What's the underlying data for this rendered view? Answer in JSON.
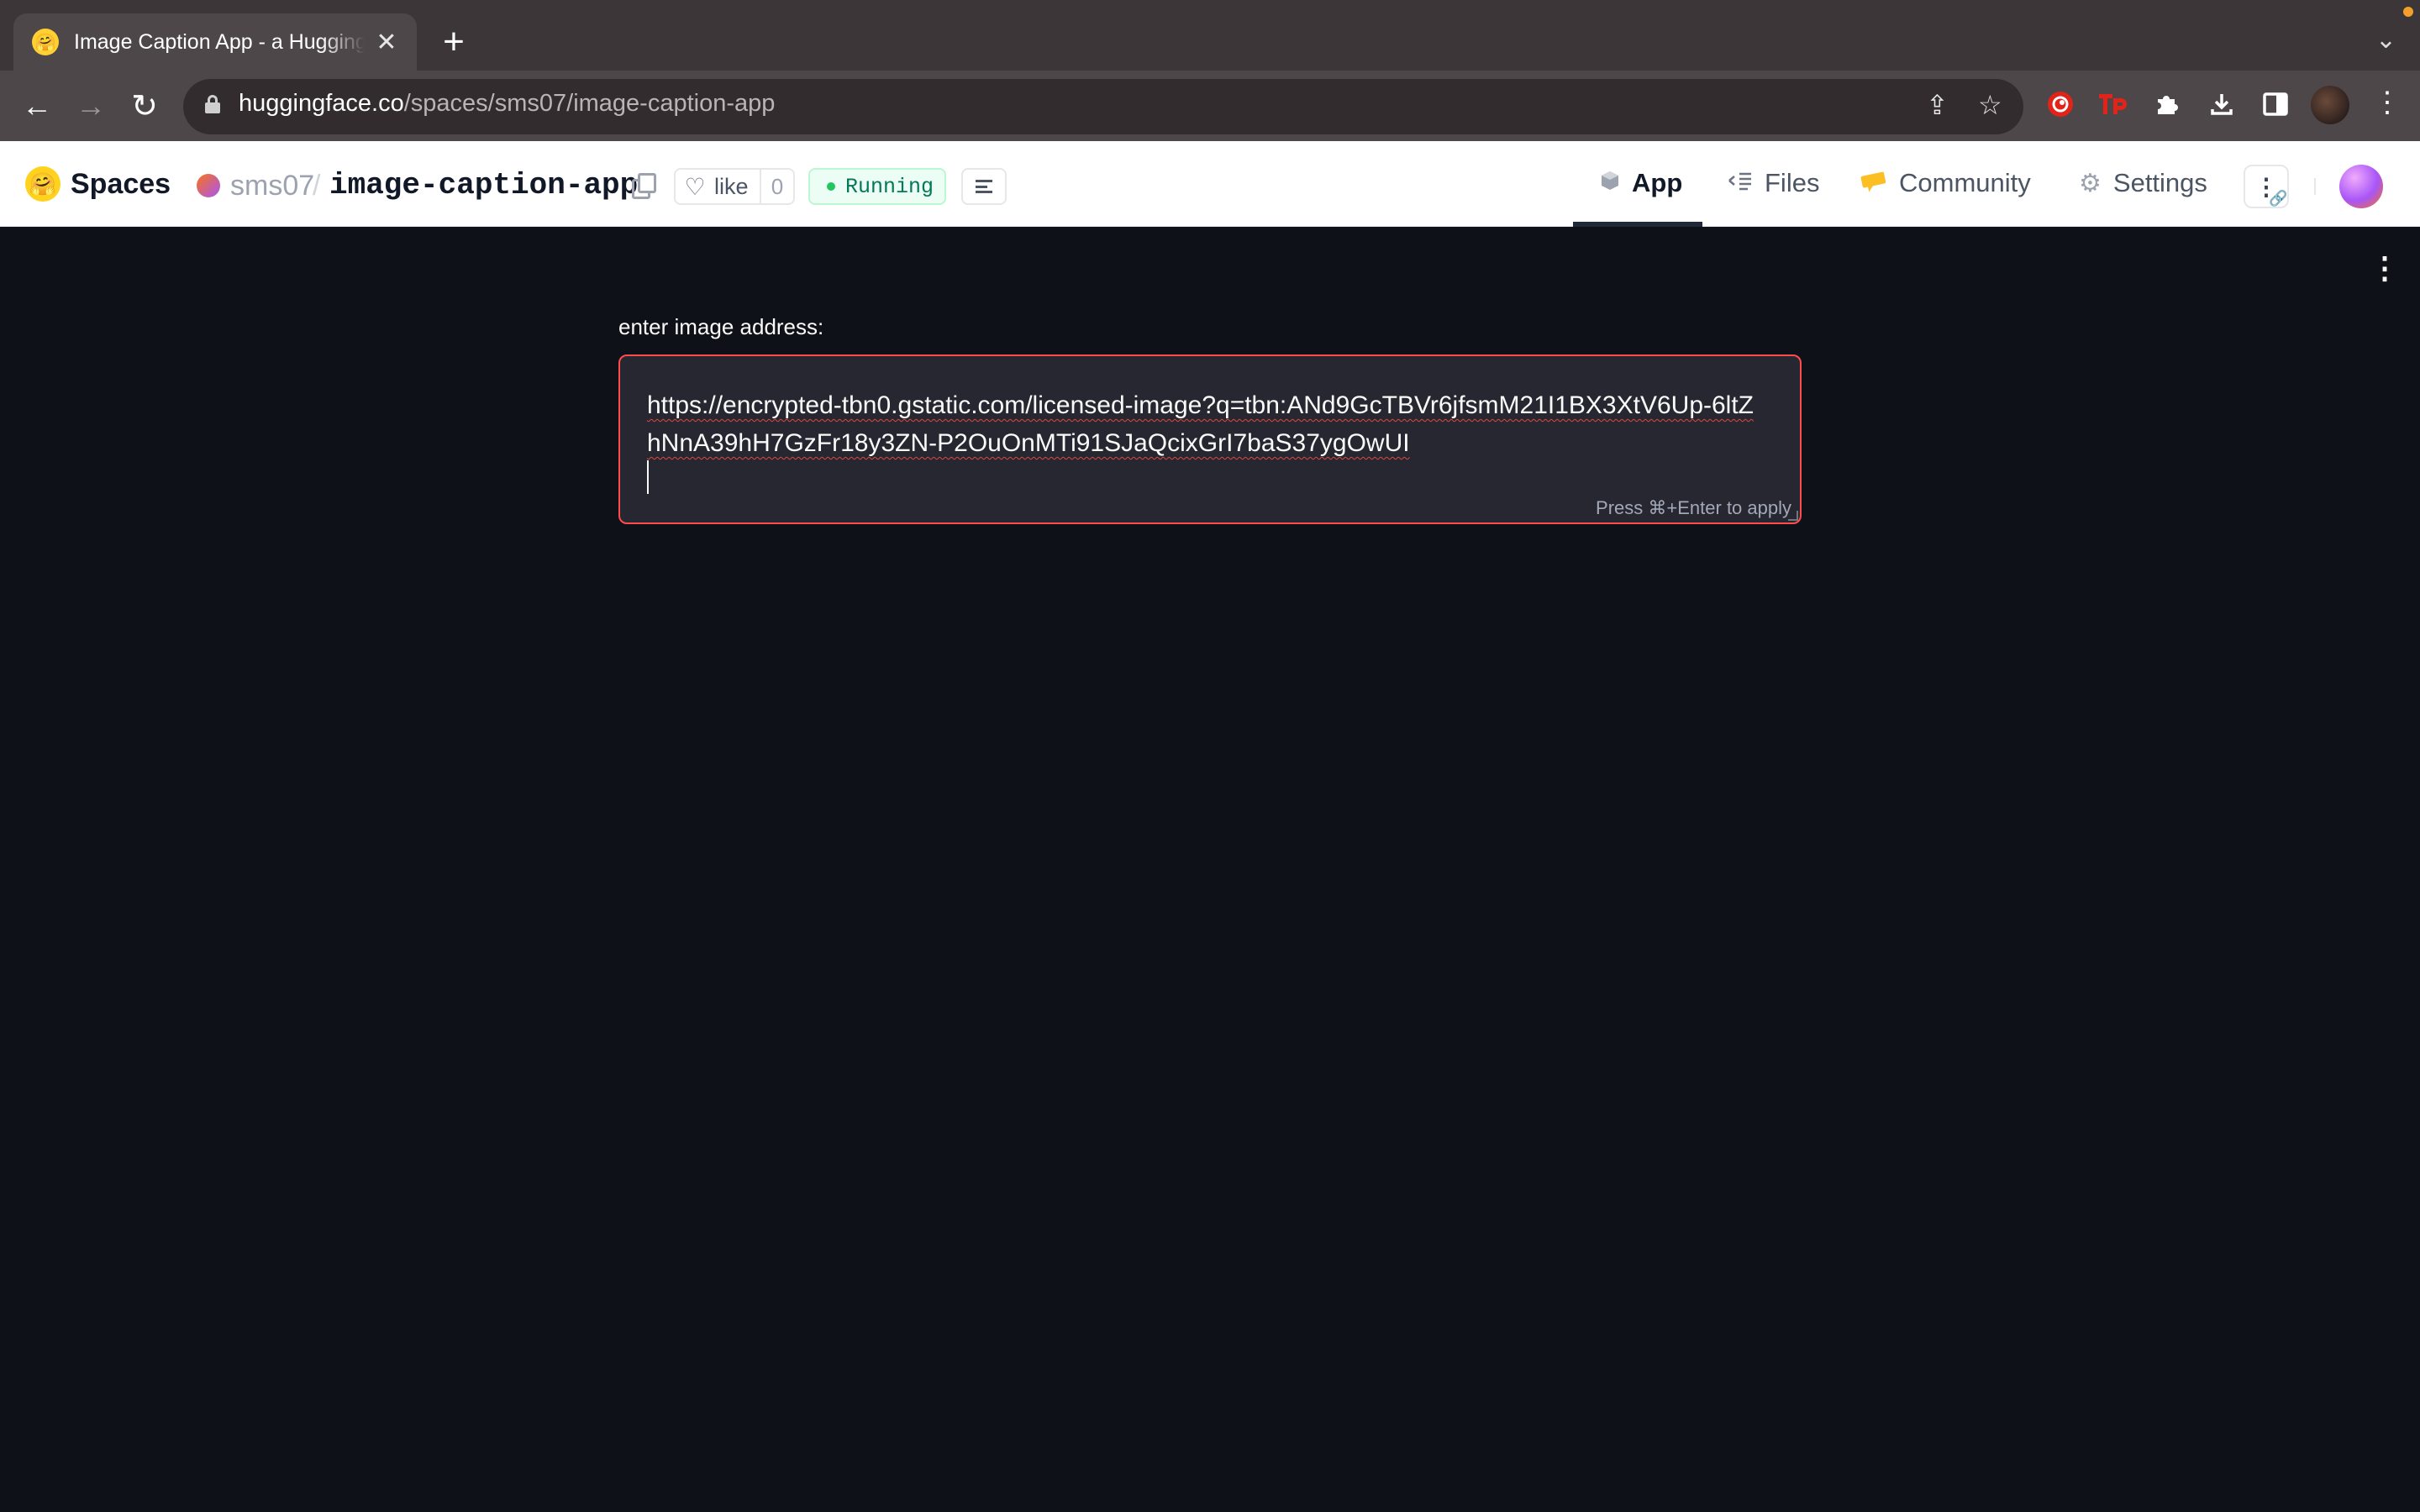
{
  "browser": {
    "tab_title": "Image Caption App - a Hugging Face Space",
    "url_host": "huggingface.co",
    "url_path": "/spaces/sms07/image-caption-app"
  },
  "header": {
    "brand": "Spaces",
    "owner": "sms07",
    "separator": "/",
    "repo": "image-caption-app",
    "like_label": "like",
    "like_count": "0",
    "status": "Running",
    "status_color": "#047857",
    "nav": {
      "app": "App",
      "files": "Files",
      "community": "Community",
      "settings": "Settings"
    }
  },
  "app": {
    "input_label": "enter image address:",
    "input_value": "https://encrypted-tbn0.gstatic.com/licensed-image?q=tbn:ANd9GcTBVr6jfsmM21I1BX3XtV6Up-6ltZhNnA39hH7GzFr18y3ZN-P2OuOnMTi91SJaQcixGrI7baS37ygOwUI",
    "hint": "Press ⌘+Enter to apply",
    "accent": "#ff4b4b"
  },
  "icons": [
    "hugging-face-icon",
    "close-icon",
    "plus-icon",
    "chevron-down-icon",
    "back-arrow-icon",
    "forward-arrow-icon",
    "reload-icon",
    "lock-icon",
    "share-icon",
    "star-icon",
    "extension-icon",
    "download-icon",
    "sidebar-icon",
    "more-vertical-icon",
    "copy-icon",
    "heart-icon",
    "logs-icon",
    "cube-icon",
    "files-icon",
    "community-icon",
    "gear-icon",
    "link-icon"
  ]
}
